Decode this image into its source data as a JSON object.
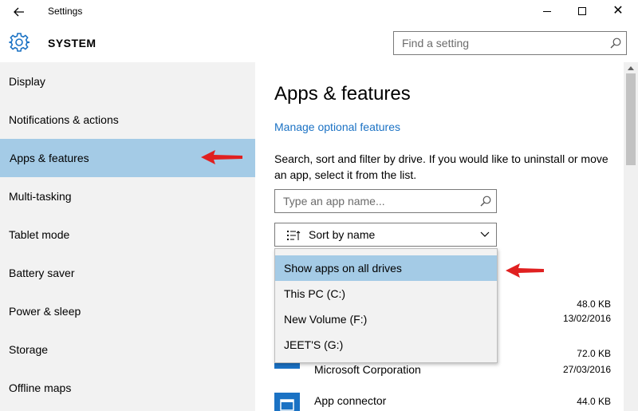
{
  "window": {
    "title": "Settings"
  },
  "header": {
    "title": "SYSTEM",
    "search_placeholder": "Find a setting"
  },
  "sidebar": {
    "items": [
      {
        "label": "Display",
        "active": false
      },
      {
        "label": "Notifications & actions",
        "active": false
      },
      {
        "label": "Apps & features",
        "active": true
      },
      {
        "label": "Multi-tasking",
        "active": false
      },
      {
        "label": "Tablet mode",
        "active": false
      },
      {
        "label": "Battery saver",
        "active": false
      },
      {
        "label": "Power & sleep",
        "active": false
      },
      {
        "label": "Storage",
        "active": false
      },
      {
        "label": "Offline maps",
        "active": false
      }
    ]
  },
  "main": {
    "title": "Apps & features",
    "link": "Manage optional features",
    "description": "Search, sort and filter by drive. If you would like to uninstall or move an app, select it from the list.",
    "app_search_placeholder": "Type an app name...",
    "sort_label": "Sort by name",
    "apps": [
      {
        "name": "",
        "publisher": "",
        "size": "48.0 KB",
        "date": "13/02/2016"
      },
      {
        "name": "",
        "publisher": "Microsoft Corporation",
        "size": "72.0 KB",
        "date": "27/03/2016"
      },
      {
        "name": "App connector",
        "publisher": "",
        "size": "44.0 KB",
        "date": ""
      }
    ]
  },
  "drive_dropdown": {
    "options": [
      {
        "label": "Show apps on all drives",
        "selected": true
      },
      {
        "label": "This PC (C:)",
        "selected": false
      },
      {
        "label": "New Volume (F:)",
        "selected": false
      },
      {
        "label": "JEET'S (G:)",
        "selected": false
      }
    ]
  },
  "colors": {
    "accent": "#1b72c4",
    "selection": "#a4cbe6",
    "sidebar_bg": "#f2f2f2",
    "annotation_arrow": "#e02020"
  },
  "icons": {
    "back": "back-arrow-icon",
    "gear": "gear-icon",
    "search": "search-icon",
    "sort": "sort-icon",
    "chevron": "chevron-down-icon"
  }
}
